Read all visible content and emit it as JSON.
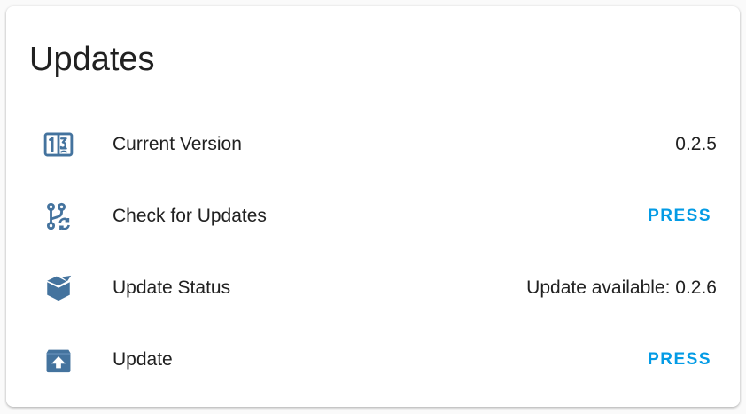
{
  "card": {
    "title": "Updates",
    "icon_color": "#44739e",
    "accent_color": "#039be5",
    "rows": [
      {
        "icon": "numeric-icon",
        "label": "Current Version",
        "value": "0.2.5"
      },
      {
        "icon": "source-branch-sync-icon",
        "label": "Check for Updates",
        "button_label": "PRESS"
      },
      {
        "icon": "package-icon",
        "label": "Update Status",
        "value": "Update available: 0.2.6"
      },
      {
        "icon": "package-up-icon",
        "label": "Update",
        "button_label": "PRESS"
      }
    ]
  }
}
